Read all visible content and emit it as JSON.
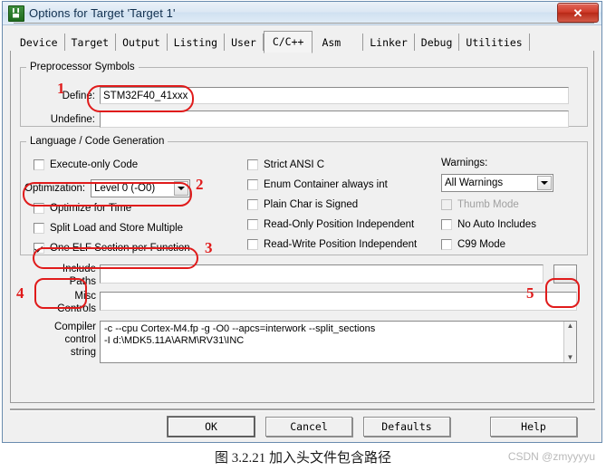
{
  "window": {
    "title": "Options for Target 'Target 1'",
    "icon": "keil-uvision-icon",
    "close_label": "✕"
  },
  "tabs": [
    {
      "label": "Device",
      "selected": false
    },
    {
      "label": "Target",
      "selected": false
    },
    {
      "label": "Output",
      "selected": false
    },
    {
      "label": "Listing",
      "selected": false
    },
    {
      "label": "User",
      "selected": false
    },
    {
      "label": "C/C++",
      "selected": true
    },
    {
      "label": "Asm",
      "selected": false
    },
    {
      "label": "Linker",
      "selected": false
    },
    {
      "label": "Debug",
      "selected": false
    },
    {
      "label": "Utilities",
      "selected": false
    }
  ],
  "preprocessor": {
    "legend": "Preprocessor Symbols",
    "define_label": "Define:",
    "define_value": "STM32F40_41xxx",
    "define_placeholder": "",
    "undefine_label": "Undefine:",
    "undefine_value": "",
    "undefine_placeholder": ""
  },
  "language": {
    "legend": "Language / Code Generation",
    "left_column": [
      {
        "label": "Execute-only Code",
        "checked": false,
        "disabled": false
      },
      {
        "label": "Optimize for Time",
        "checked": false,
        "disabled": false
      },
      {
        "label": "Split Load and Store Multiple",
        "checked": false,
        "disabled": false
      },
      {
        "label": "One ELF Section per Function",
        "checked": true,
        "disabled": false
      }
    ],
    "optimization_label": "Optimization:",
    "optimization_value": "Level 0 (-O0)",
    "middle_column": [
      {
        "label": "Strict ANSI C",
        "checked": false,
        "disabled": false
      },
      {
        "label": "Enum Container always int",
        "checked": false,
        "disabled": false
      },
      {
        "label": "Plain Char is Signed",
        "checked": false,
        "disabled": false
      },
      {
        "label": "Read-Only Position Independent",
        "checked": false,
        "disabled": false
      },
      {
        "label": "Read-Write Position Independent",
        "checked": false,
        "disabled": false
      }
    ],
    "warnings_label": "Warnings:",
    "warnings_value": "All Warnings",
    "right_column": [
      {
        "label": "Thumb Mode",
        "checked": false,
        "disabled": true
      },
      {
        "label": "No Auto Includes",
        "checked": false,
        "disabled": false
      },
      {
        "label": "C99 Mode",
        "checked": false,
        "disabled": false
      }
    ]
  },
  "paths": {
    "include_label_line1": "Include",
    "include_label_line2": "Paths",
    "include_value": "",
    "include_placeholder": "",
    "browse_label": "...",
    "misc_label_line1": "Misc",
    "misc_label_line2": "Controls",
    "misc_value": "",
    "misc_placeholder": ""
  },
  "compiler": {
    "label_line1": "Compiler",
    "label_line2": "control",
    "label_line3": "string",
    "value": "-c --cpu Cortex-M4.fp -g -O0 --apcs=interwork --split_sections\n-I d:\\MDK5.11A\\ARM\\RV31\\INC",
    "scroll_up": "▲",
    "scroll_down": "▼"
  },
  "buttons": {
    "ok": "OK",
    "cancel": "Cancel",
    "defaults": "Defaults",
    "help": "Help"
  },
  "annotations": {
    "color": "#e01b1b",
    "markers": [
      {
        "number": "1",
        "target": "define-field"
      },
      {
        "number": "2",
        "target": "optimization-combo"
      },
      {
        "number": "3",
        "target": "one-elf-section-checkbox"
      },
      {
        "number": "4",
        "target": "include-paths-label"
      },
      {
        "number": "5",
        "target": "include-paths-browse-button"
      }
    ]
  },
  "caption": {
    "text": "图 3.2.21 加入头文件包含路径",
    "watermark": "CSDN @zmyyyyu"
  }
}
